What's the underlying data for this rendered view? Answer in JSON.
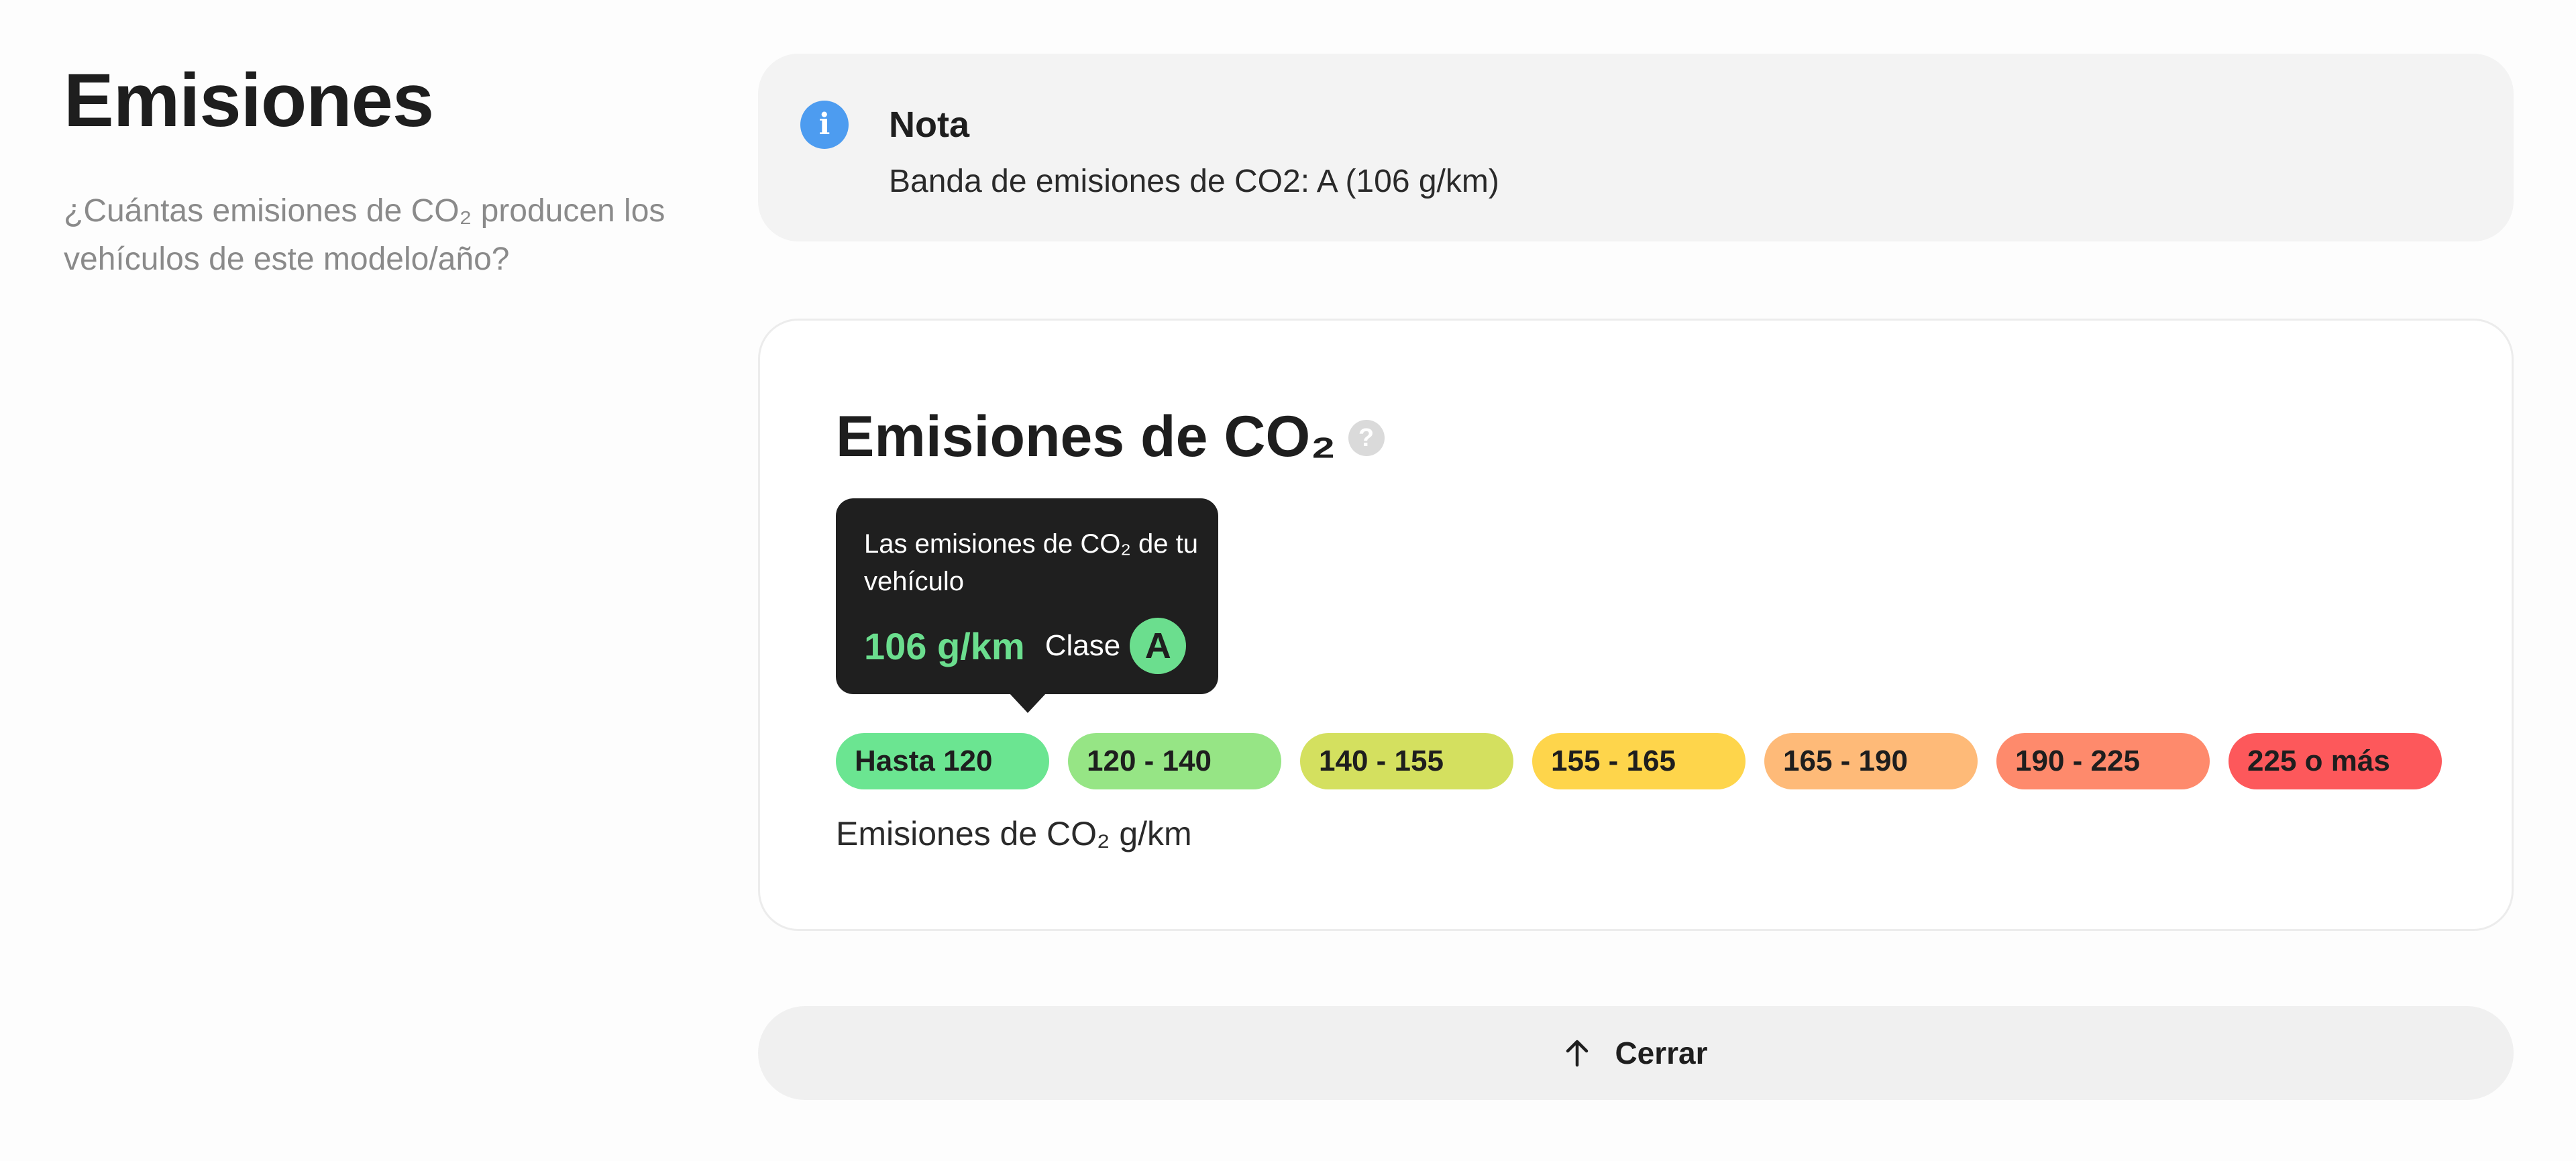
{
  "header": {
    "title": "Emisiones",
    "subtitle": "¿Cuántas emisiones de CO₂ producen los vehículos de este modelo/año?"
  },
  "note": {
    "icon": "info-icon",
    "icon_glyph": "i",
    "title": "Nota",
    "text": "Banda de emisiones de CO2: A (106 g/km)",
    "accent_color": "#4d9cf0"
  },
  "emissions_card": {
    "title": "Emisiones de CO₂",
    "help_icon": "question-icon",
    "help_glyph": "?",
    "tooltip": {
      "text": "Las emisiones de CO₂ de tu vehículo",
      "value": "106 g/km",
      "class_label": "Clase",
      "class_value": "A",
      "highlight_color": "#6bde8e"
    },
    "bands": [
      {
        "label": "Hasta 120",
        "color": "#6be591"
      },
      {
        "label": "120 - 140",
        "color": "#96e585"
      },
      {
        "label": "140 - 155",
        "color": "#d4e05f"
      },
      {
        "label": "155 - 165",
        "color": "#fed54b"
      },
      {
        "label": "165 - 190",
        "color": "#feba78"
      },
      {
        "label": "190 - 225",
        "color": "#fe8a6c"
      },
      {
        "label": "225 o más",
        "color": "#fd585b"
      }
    ],
    "unit_label": "Emisiones de CO₂ g/km"
  },
  "close_button": {
    "icon": "arrow-up-icon",
    "label": "Cerrar"
  }
}
